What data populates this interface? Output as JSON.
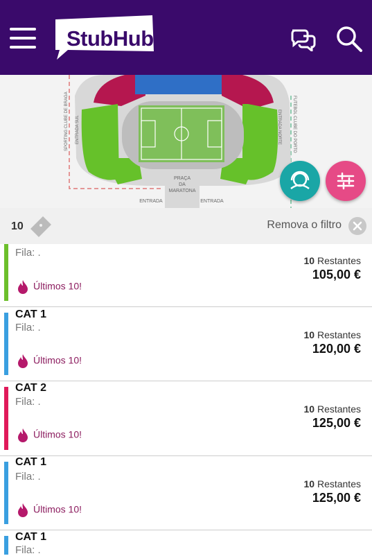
{
  "header": {
    "logo_text": "StubHub",
    "bg_color": "#3a0a6b"
  },
  "map": {
    "label_left": "SPORTING CLUBE DE BRAGA",
    "label_entrada_sul": "ENTRADA SUL",
    "label_right": "FUTEBOL CLUBE DO PORTO",
    "label_entrada_norte": "ENTRADA NORTE",
    "label_praca": [
      "PRAÇA",
      "DA",
      "MARATONA"
    ],
    "label_entrada_1": "ENTRADA",
    "label_entrada_2": "ENTRADA"
  },
  "filter": {
    "quantity": "10",
    "remove_label": "Remova o filtro"
  },
  "listings": [
    {
      "cat": "",
      "fila": "Fila: .",
      "hot": "Últimos 10!",
      "count": "10",
      "remaining": "Restantes",
      "price": "105,00 €",
      "color": "#6cbf2b"
    },
    {
      "cat": "CAT 1",
      "fila": "Fila: .",
      "hot": "Últimos 10!",
      "count": "10",
      "remaining": "Restantes",
      "price": "120,00 €",
      "color": "#3a9fe0"
    },
    {
      "cat": "CAT 2",
      "fila": "Fila: .",
      "hot": "Últimos 10!",
      "count": "10",
      "remaining": "Restantes",
      "price": "125,00 €",
      "color": "#e0195a"
    },
    {
      "cat": "CAT 1",
      "fila": "Fila: .",
      "hot": "Últimos 10!",
      "count": "10",
      "remaining": "Restantes",
      "price": "125,00 €",
      "color": "#3a9fe0"
    },
    {
      "cat": "CAT 1",
      "fila": "Fila: .",
      "hot": "",
      "count": "",
      "remaining": "",
      "price": "",
      "color": "#3a9fe0"
    }
  ]
}
